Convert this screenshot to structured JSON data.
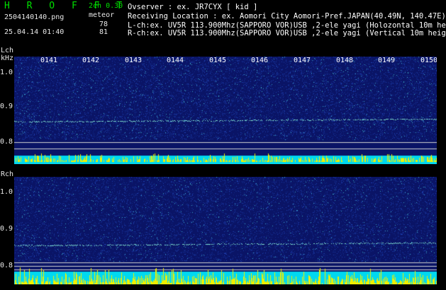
{
  "header": {
    "app_title": "H R O F F T",
    "version": "2ch 0.30",
    "file_name": "2504140140.png",
    "meteor_label": "meteor",
    "datetime": "25.04.14 01:40",
    "count_l": "78",
    "count_r": "81",
    "observer": "Ovserver           : ex. JR7CYX [ kid ]",
    "location": "Receiving Location : ex. Aomori City Aomori-Pref.JAPAN(40.49N, 140.47E)",
    "lch_info": "L-ch:ex. UV5R 113.900Mhz(SAPPORO VOR)USB ,2-ele yagi (Holozontal 10m height)",
    "rch_info": "R-ch:ex. UV5R 113.900Mhz(SAPPORO VOR)USB ,2-ele yagi (Vertical 10m height)"
  },
  "lch": {
    "label": "Lch",
    "unit": "kHz",
    "y_ticks": [
      "1.0",
      "0.9",
      "0.8"
    ],
    "time_labels": [
      "0141",
      "0142",
      "0143",
      "0144",
      "0145",
      "0146",
      "0147",
      "0148",
      "0149",
      "0150"
    ]
  },
  "rch": {
    "label": "Rch",
    "y_ticks": [
      "1.0",
      "0.9",
      "0.8"
    ]
  },
  "colors": {
    "panel_bg": "#0a1466",
    "noise_low": "#1d3fb0",
    "noise_high": "#3aa6c8",
    "carrier": "#7fe0d0",
    "level_base": "#00d8f0",
    "level_peak": "#f0f000",
    "grid_line": "#d0d0d0"
  }
}
